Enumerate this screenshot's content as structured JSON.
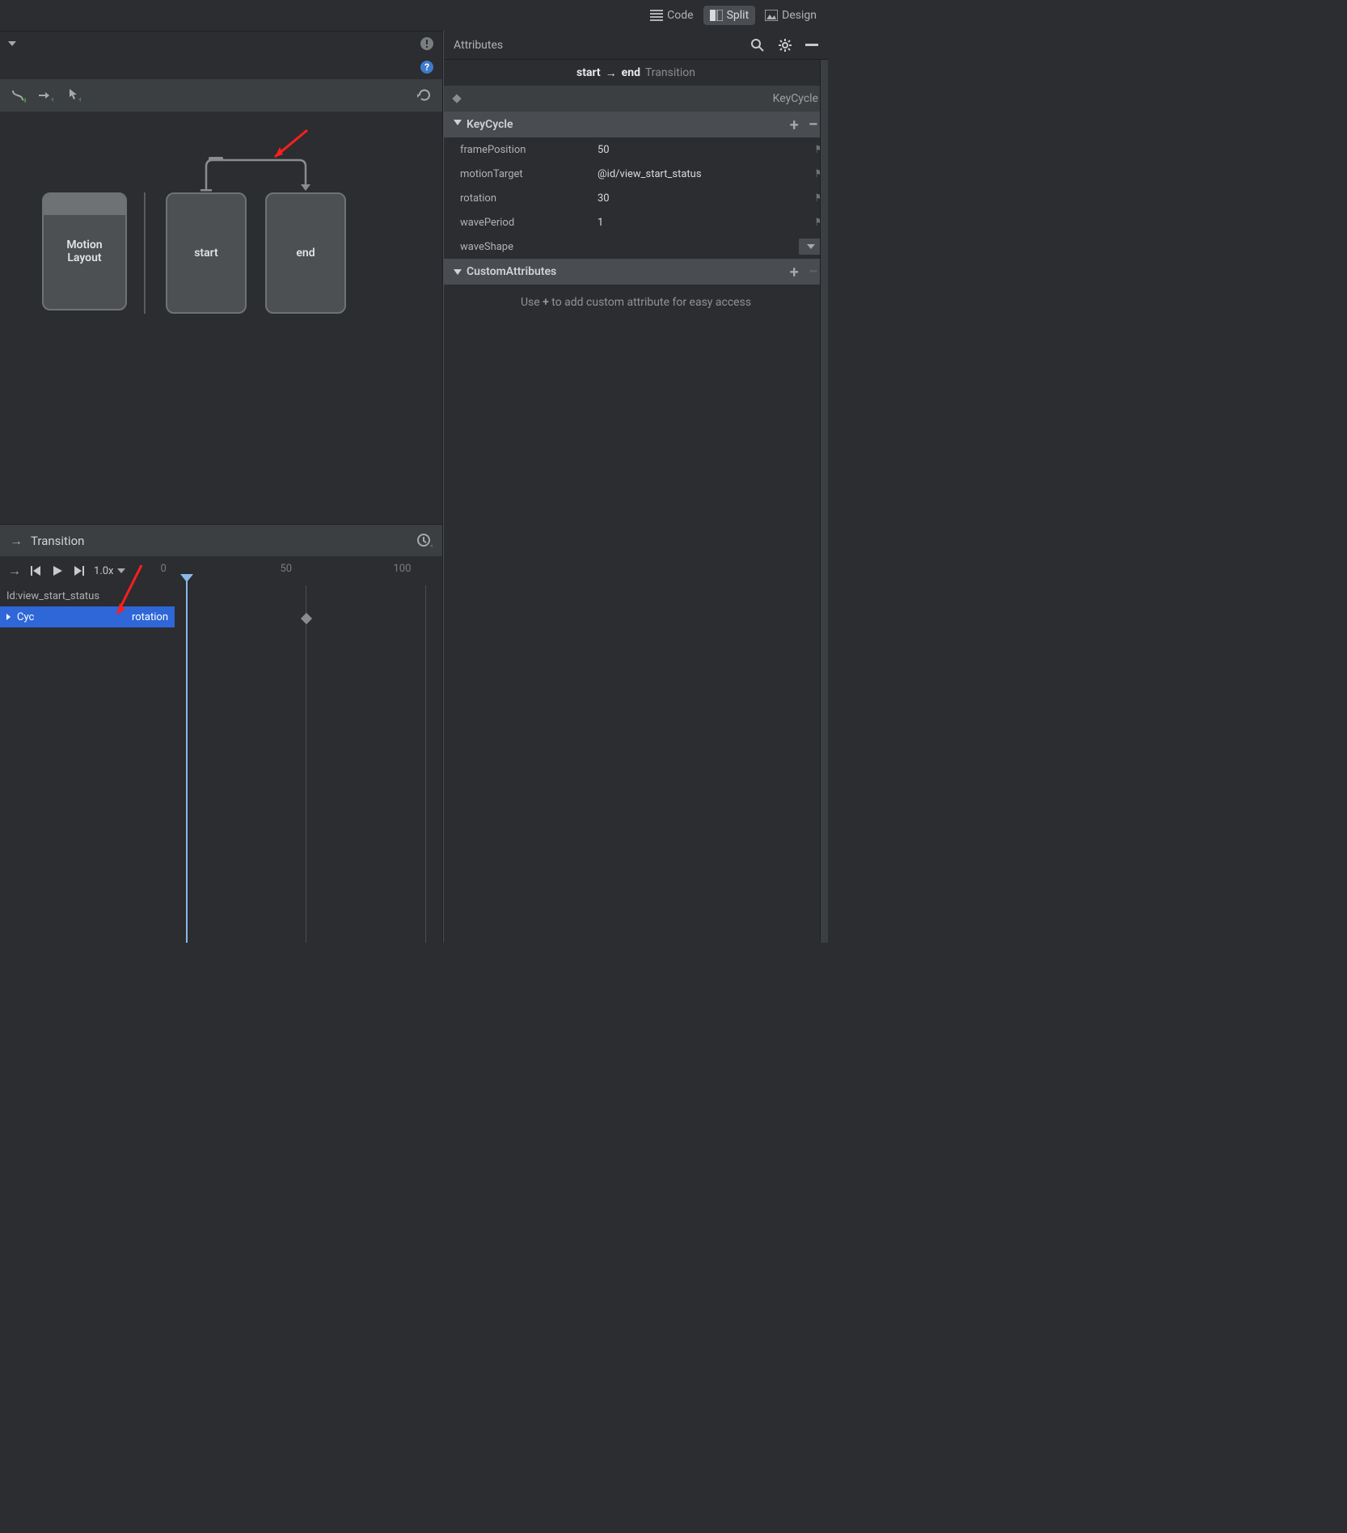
{
  "topBar": {
    "code": "Code",
    "split": "Split",
    "design": "Design"
  },
  "toolStrip": {},
  "canvas": {
    "motionLayout": "Motion\nLayout",
    "start": "start",
    "end": "end"
  },
  "timelineHeader": {
    "title": "Transition",
    "speed": "1.0x",
    "ticks": [
      "0",
      "50",
      "100"
    ]
  },
  "timeline": {
    "idRow": "Id:view_start_status",
    "cycRow": {
      "left": "Cyc",
      "right": "rotation"
    }
  },
  "attributes": {
    "title": "Attributes",
    "breadcrumb": {
      "from": "start",
      "to": "end",
      "kind": "Transition"
    },
    "keycycleLabel": "KeyCycle",
    "sections": {
      "keycycle": "KeyCycle",
      "custom": "CustomAttributes"
    },
    "props": {
      "framePosition": {
        "k": "framePosition",
        "v": "50"
      },
      "motionTarget": {
        "k": "motionTarget",
        "v": "@id/view_start_status"
      },
      "rotation": {
        "k": "rotation",
        "v": "30"
      },
      "wavePeriod": {
        "k": "wavePeriod",
        "v": "1"
      },
      "waveShape": {
        "k": "waveShape",
        "v": ""
      }
    },
    "hint_pre": "Use ",
    "hint_plus": "+",
    "hint_post": " to add custom attribute for easy access"
  }
}
